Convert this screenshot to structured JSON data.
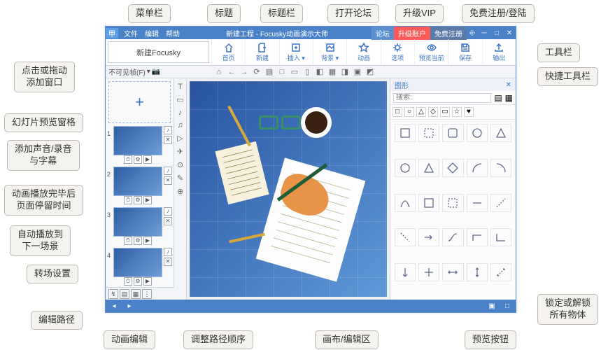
{
  "callouts": {
    "menubar": "菜单栏",
    "title_label": "标题",
    "titlebar": "标题栏",
    "forum": "打开论坛",
    "vip": "升级VIP",
    "register": "免费注册/登陆",
    "toolbar": "工具栏",
    "quickbar": "快捷工具栏",
    "add_window": "点击或拖动\n添加窗口",
    "slide_pane": "幻灯片预览窗格",
    "add_audio": "添加声音/录音\n与字幕",
    "stay_time": "动画播放完毕后\n页面停留时间",
    "auto_next": "自动播放到\n下一场景",
    "transition": "转场设置",
    "edit_path": "编辑路径",
    "anim_edit": "动画编辑",
    "reorder": "调整路径顺序",
    "canvas": "画布/编辑区",
    "preview_btn": "预览按钮",
    "lock": "锁定或解锁\n所有物体"
  },
  "titlebar": {
    "menus": [
      "文件",
      "编辑",
      "帮助"
    ],
    "title": "新建工程 - Focusky动画演示大师",
    "forum": "论坛",
    "vip": "升级账户",
    "register": "免费注册",
    "login_icon": "⎆",
    "min": "─",
    "max": "□",
    "close": "✕"
  },
  "toolbar": {
    "new_focusky": "新建Focusky",
    "items": [
      {
        "label": "首页",
        "icon": "home"
      },
      {
        "label": "新建",
        "icon": "plus"
      },
      {
        "label": "插入 ▾",
        "icon": "insert"
      },
      {
        "label": "背景 ▾",
        "icon": "bg"
      },
      {
        "label": "动画",
        "icon": "star"
      },
      {
        "label": "选项",
        "icon": "gear"
      },
      {
        "label": "预览当前",
        "icon": "eye"
      },
      {
        "label": "保存",
        "icon": "save"
      },
      {
        "label": "输出",
        "icon": "export"
      }
    ]
  },
  "quickbar": {
    "visibility": "不可见帧(F)",
    "cam": "📷",
    "mid": [
      "⌂",
      "←",
      "→",
      "⟳",
      "▤",
      "□",
      "▭",
      "▯",
      "◧",
      "▦",
      "◨",
      "▣",
      "◩"
    ]
  },
  "side": {
    "add": "+",
    "slides": [
      1,
      2,
      3,
      4
    ]
  },
  "side_tools": [
    "↯",
    "▤",
    "▦",
    "⋮"
  ],
  "vstrip": [
    "T",
    "▭",
    "♪",
    "♫",
    "▷",
    "✈",
    "⊙",
    "✎",
    "⊕"
  ],
  "rpanel": {
    "head": "图形",
    "search_placeholder": "搜索:",
    "cats": [
      "□",
      "○",
      "△",
      "◇",
      "▭",
      "☆",
      "♥"
    ]
  },
  "status": {
    "left": [
      "◂",
      "▸"
    ],
    "right": [
      "▣",
      "□"
    ]
  },
  "shape_icons": [
    "rect",
    "rect-d",
    "roundrect",
    "circle",
    "triangle",
    "circle",
    "triangle",
    "rhombus",
    "arc",
    "arc2",
    "curve",
    "rect-sel",
    "rect-dash",
    "line-h",
    "line-d",
    "line-d2",
    "arrow",
    "curve2",
    "elbow",
    "elbow2",
    "arrow-v",
    "cross",
    "dbl-h",
    "dbl-v",
    "dbl-d"
  ]
}
